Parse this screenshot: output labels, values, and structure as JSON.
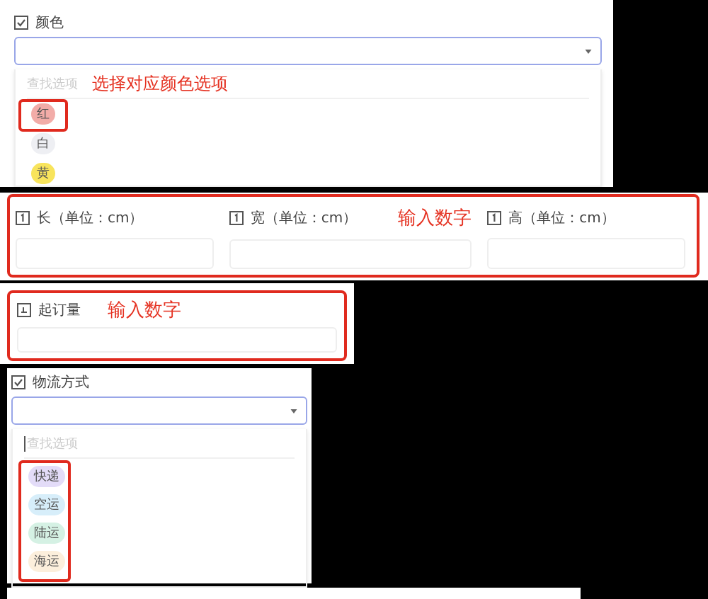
{
  "color_field": {
    "label": "颜色",
    "search_placeholder": "查找选项",
    "annotation": "选择对应颜色选项",
    "options": [
      {
        "label": "红",
        "color": "#f2aca8"
      },
      {
        "label": "白",
        "color": "#eeeff3"
      },
      {
        "label": "黄",
        "color": "#f8e45c"
      }
    ]
  },
  "dimension_fields": {
    "annotation": "输入数字",
    "fields": [
      {
        "label": "长（单位：cm）"
      },
      {
        "label": "宽（单位：cm）"
      },
      {
        "label": "高（单位：cm）"
      }
    ]
  },
  "min_order_field": {
    "label": "起订量",
    "annotation": "输入数字"
  },
  "shipping_field": {
    "label": "物流方式",
    "search_placeholder": "查找选项",
    "options": [
      {
        "label": "快递",
        "color": "#e3dcf8"
      },
      {
        "label": "空运",
        "color": "#d7eefa"
      },
      {
        "label": "陆运",
        "color": "#d5f1e4"
      },
      {
        "label": "海运",
        "color": "#fcefdc"
      }
    ]
  }
}
